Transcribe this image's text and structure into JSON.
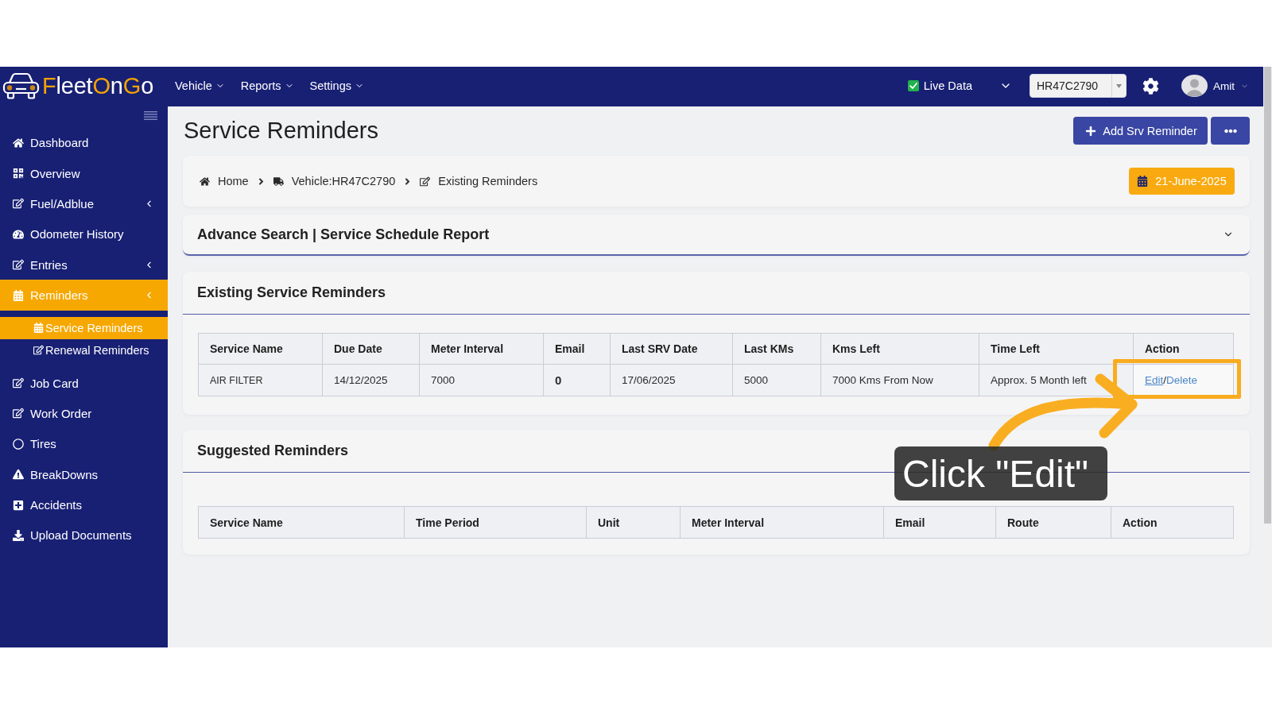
{
  "navbar": {
    "logo": [
      {
        "text": "F",
        "color": "#f5a300"
      },
      {
        "text": "leet",
        "color": "#ffffff"
      },
      {
        "text": "O",
        "color": "#f5a300"
      },
      {
        "text": "n",
        "color": "#ffffff"
      },
      {
        "text": "G",
        "color": "#f5a300"
      },
      {
        "text": "o",
        "color": "#ffffff"
      }
    ],
    "menus": [
      {
        "label": "Vehicle"
      },
      {
        "label": "Reports"
      },
      {
        "label": "Settings"
      }
    ],
    "live_data": {
      "label": "Live Data",
      "checked": true
    },
    "vehicle_select": {
      "value": "HR47C2790"
    },
    "user": {
      "name": "Amit"
    }
  },
  "sidebar": {
    "items": [
      {
        "label": "Dashboard",
        "kind": "link",
        "selected": false
      },
      {
        "label": "Overview",
        "kind": "link",
        "selected": false
      },
      {
        "label": "Fuel/Adblue",
        "kind": "group",
        "selected": false
      },
      {
        "label": "Odometer History",
        "kind": "link",
        "selected": false
      },
      {
        "label": "Entries",
        "kind": "group",
        "selected": false
      },
      {
        "label": "Reminders",
        "kind": "group",
        "selected": true,
        "children": [
          {
            "label": "Service Reminders",
            "selected": true
          },
          {
            "label": "Renewal Reminders",
            "selected": false
          }
        ]
      },
      {
        "label": "Job Card",
        "kind": "link",
        "selected": false
      },
      {
        "label": "Work Order",
        "kind": "link",
        "selected": false
      },
      {
        "label": "Tires",
        "kind": "link",
        "selected": false
      },
      {
        "label": "BreakDowns",
        "kind": "link",
        "selected": false
      },
      {
        "label": "Accidents",
        "kind": "link",
        "selected": false
      },
      {
        "label": "Upload Documents",
        "kind": "link",
        "selected": false
      }
    ]
  },
  "page": {
    "title": "Service Reminders",
    "buttons": [
      {
        "kind": "add",
        "label": "Add Srv Reminder"
      },
      {
        "kind": "more"
      }
    ]
  },
  "breadcrumb": {
    "items": [
      {
        "label": "Home"
      },
      {
        "label": "Vehicle:HR47C2790"
      },
      {
        "label": "Existing Reminders"
      }
    ],
    "date": "21-June-2025"
  },
  "advance_search": {
    "title": "Advance Search | Service Schedule Report",
    "expanded": false
  },
  "existing": {
    "title": "Existing Service Reminders",
    "columns": [
      "Service Name",
      "Due Date",
      "Meter Interval",
      "Email",
      "Last SRV Date",
      "Last KMs",
      "Kms Left",
      "Time Left",
      "Action"
    ],
    "rows": [
      {
        "cells": [
          {
            "kind": "name",
            "text": "AIR FILTER"
          },
          {
            "kind": "text",
            "text": "14/12/2025"
          },
          {
            "kind": "text",
            "text": "7000"
          },
          {
            "kind": "count",
            "text": "0"
          },
          {
            "kind": "text",
            "text": "17/06/2025"
          },
          {
            "kind": "text",
            "text": "5000"
          },
          {
            "kind": "text",
            "text": "7000 Kms From Now"
          },
          {
            "kind": "text",
            "text": "Approx. 5 Month left"
          },
          {
            "kind": "actions",
            "separator": "/",
            "links": [
              {
                "label": "Edit",
                "hovered": true
              },
              {
                "label": "Delete",
                "hovered": false
              }
            ]
          }
        ]
      }
    ]
  },
  "suggested": {
    "title": "Suggested Reminders",
    "columns": [
      "Service Name",
      "Time Period",
      "Unit",
      "Meter Interval",
      "Email",
      "Route",
      "Action"
    ]
  },
  "callout": {
    "text": "Click \"Edit\""
  }
}
